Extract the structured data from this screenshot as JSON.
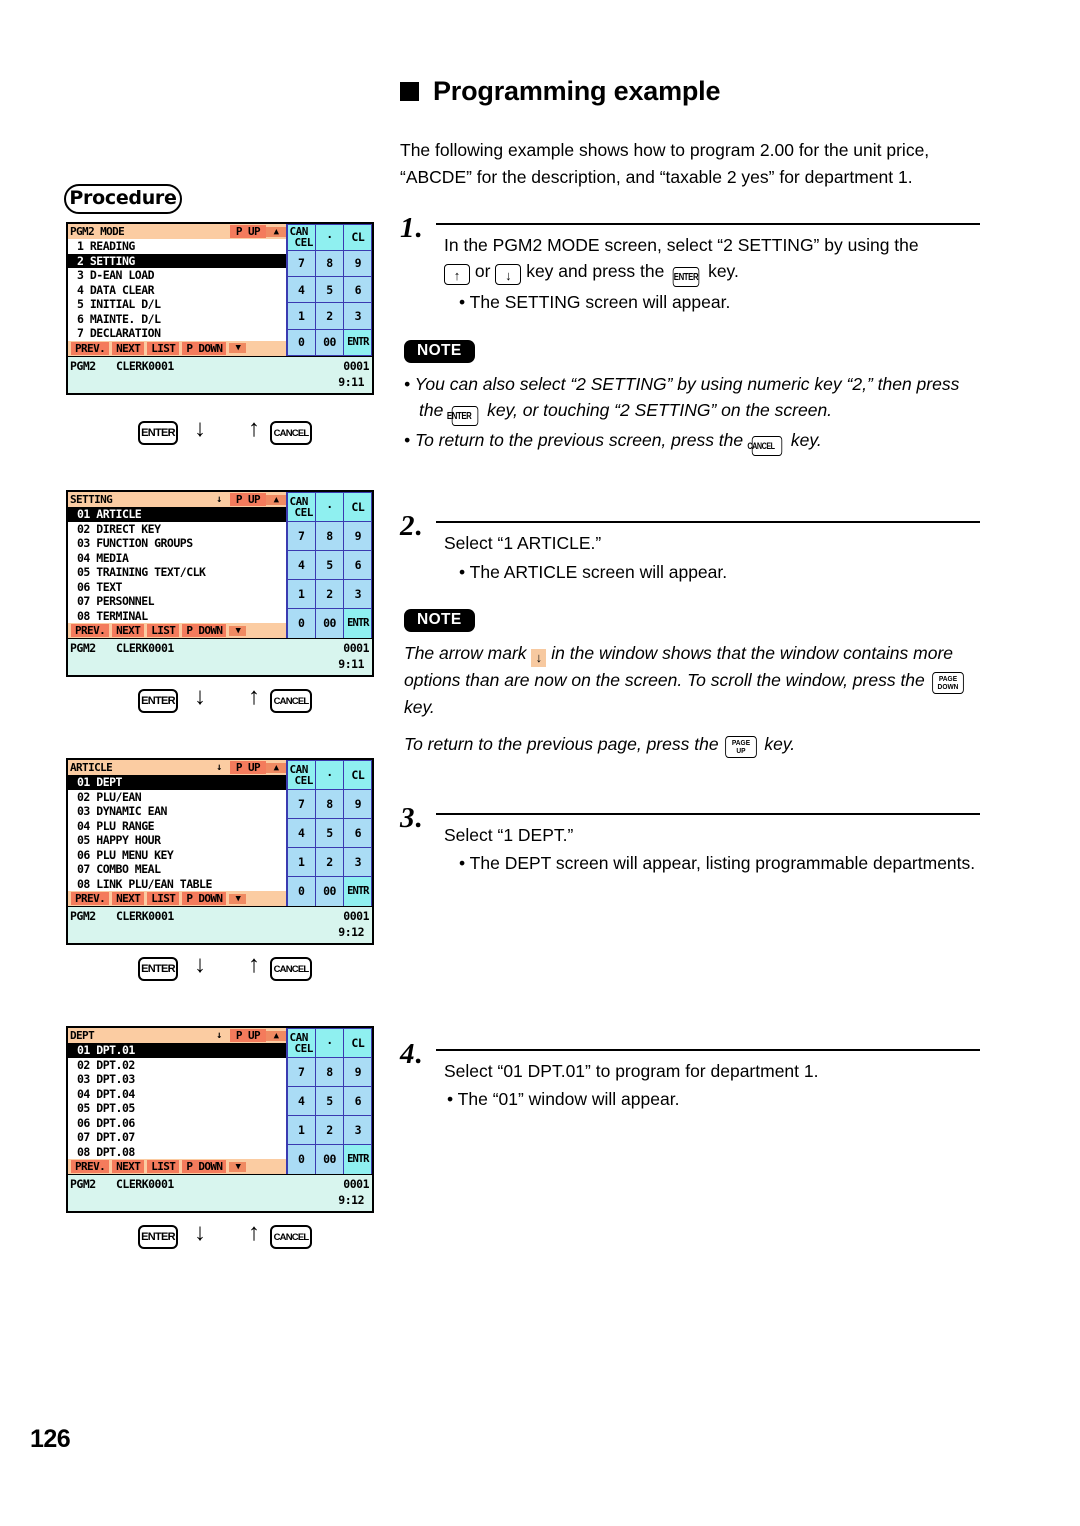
{
  "page": {
    "number": "126",
    "procedure_label": "Procedure"
  },
  "heading": {
    "title": "Programming example"
  },
  "intro": {
    "line1": "The following example shows how to program 2.00 for the unit price,",
    "line2": "“ABCDE” for the description, and “taxable 2 yes” for department 1."
  },
  "note_badge_label": "NOTE",
  "steps": [
    {
      "num": "1",
      "text_a": "In the PGM2 MODE screen, select “2 SETTING” by using the",
      "key_up": "↑",
      "text_or": "or",
      "key_down": "↓",
      "text_b": "key and press the",
      "key_enter": "ENTER",
      "text_c": "key.",
      "bullet": "• The SETTING screen will appear.",
      "note_items": [
        {
          "part_a": "• You can also select “2 SETTING” by using numeric key “2,” then press the",
          "key": "ENTER",
          "part_b": "key, or touching “2 SETTING” on the screen."
        },
        {
          "part_a": "• To return to the previous screen, press the",
          "key": "CANCEL",
          "part_b": "key."
        }
      ]
    },
    {
      "num": "2",
      "text_a": "Select “1 ARTICLE.”",
      "bullet": "• The ARTICLE screen will appear.",
      "note_paras": [
        {
          "part_a": "The arrow mark",
          "mark": "↓",
          "part_b": "in the window shows that the window contains more options than are now on the screen. To scroll the window, press the",
          "key_line1": "PAGE",
          "key_line2": "DOWN",
          "part_c": "key."
        },
        {
          "part_a": "To return to the previous page, press the",
          "key_line1": "PAGE",
          "key_line2": "UP",
          "part_c": "key."
        }
      ]
    },
    {
      "num": "3",
      "text_a": "Select “1 DEPT.”",
      "bullet": "• The DEPT screen will appear, listing programmable departments."
    },
    {
      "num": "4",
      "text_a": "Select “01 DPT.01” to program for department 1.",
      "bullet": "• The “01” window will appear."
    }
  ],
  "keyrow": {
    "enter": "ENTER",
    "down": "↓",
    "up": "↑",
    "cancel": "CANCEL"
  },
  "keypad": {
    "cancel_line1": "CAN",
    "cancel_line2": "CEL",
    "dot": "·",
    "cl": "CL",
    "k7": "7",
    "k8": "8",
    "k9": "9",
    "k4": "4",
    "k5": "5",
    "k6": "6",
    "k1": "1",
    "k2": "2",
    "k3": "3",
    "k0": "0",
    "k00": "00",
    "entr": "ENTR"
  },
  "fnbar": {
    "prev": "PREV.",
    "next": "NEXT",
    "list": "LIST",
    "pdown": "P DOWN",
    "down_mark": "▼"
  },
  "titlebar": {
    "pup": "P UP",
    "up_mark": "▲",
    "down_mark": "↓"
  },
  "screens": [
    {
      "title": "PGM2 MODE",
      "has_down_arrow": false,
      "rows": [
        {
          "text": "1 READING",
          "selected": false
        },
        {
          "text": "2 SETTING",
          "selected": true
        },
        {
          "text": "3 D-EAN LOAD",
          "selected": false
        },
        {
          "text": "4 DATA CLEAR",
          "selected": false
        },
        {
          "text": "5 INITIAL D/L",
          "selected": false
        },
        {
          "text": "6 MAINTE. D/L",
          "selected": false
        },
        {
          "text": "7 DECLARATION",
          "selected": false
        }
      ],
      "status": {
        "mode": "PGM2",
        "clerk": "CLERK0001",
        "number": "0001",
        "time": "9:11"
      }
    },
    {
      "title": "SETTING",
      "has_down_arrow": true,
      "rows": [
        {
          "text": "01 ARTICLE",
          "selected": true
        },
        {
          "text": "02 DIRECT KEY",
          "selected": false
        },
        {
          "text": "03 FUNCTION GROUPS",
          "selected": false
        },
        {
          "text": "04 MEDIA",
          "selected": false
        },
        {
          "text": "05 TRAINING TEXT/CLK",
          "selected": false
        },
        {
          "text": "06 TEXT",
          "selected": false
        },
        {
          "text": "07 PERSONNEL",
          "selected": false
        },
        {
          "text": "08 TERMINAL",
          "selected": false
        }
      ],
      "status": {
        "mode": "PGM2",
        "clerk": "CLERK0001",
        "number": "0001",
        "time": "9:11"
      }
    },
    {
      "title": "ARTICLE",
      "has_down_arrow": true,
      "rows": [
        {
          "text": "01 DEPT",
          "selected": true
        },
        {
          "text": "02 PLU/EAN",
          "selected": false
        },
        {
          "text": "03 DYNAMIC EAN",
          "selected": false
        },
        {
          "text": "04 PLU RANGE",
          "selected": false
        },
        {
          "text": "05 HAPPY HOUR",
          "selected": false
        },
        {
          "text": "06 PLU MENU KEY",
          "selected": false
        },
        {
          "text": "07 COMBO MEAL",
          "selected": false
        },
        {
          "text": "08 LINK PLU/EAN TABLE",
          "selected": false
        }
      ],
      "status": {
        "mode": "PGM2",
        "clerk": "CLERK0001",
        "number": "0001",
        "time": "9:12"
      }
    },
    {
      "title": "DEPT",
      "has_down_arrow": true,
      "rows": [
        {
          "text": "01 DPT.01",
          "selected": true
        },
        {
          "text": "02 DPT.02",
          "selected": false
        },
        {
          "text": "03 DPT.03",
          "selected": false
        },
        {
          "text": "04 DPT.04",
          "selected": false
        },
        {
          "text": "05 DPT.05",
          "selected": false
        },
        {
          "text": "06 DPT.06",
          "selected": false
        },
        {
          "text": "07 DPT.07",
          "selected": false
        },
        {
          "text": "08 DPT.08",
          "selected": false
        }
      ],
      "status": {
        "mode": "PGM2",
        "clerk": "CLERK0001",
        "number": "0001",
        "time": "9:12"
      }
    }
  ],
  "colors": {
    "titlebar": "#fbcca2",
    "accent_orange": "#f47b5c",
    "keypad_blue": "#aadcf5",
    "keypad_cyan": "#8ff0f0",
    "status_green": "#d8f5ee"
  }
}
